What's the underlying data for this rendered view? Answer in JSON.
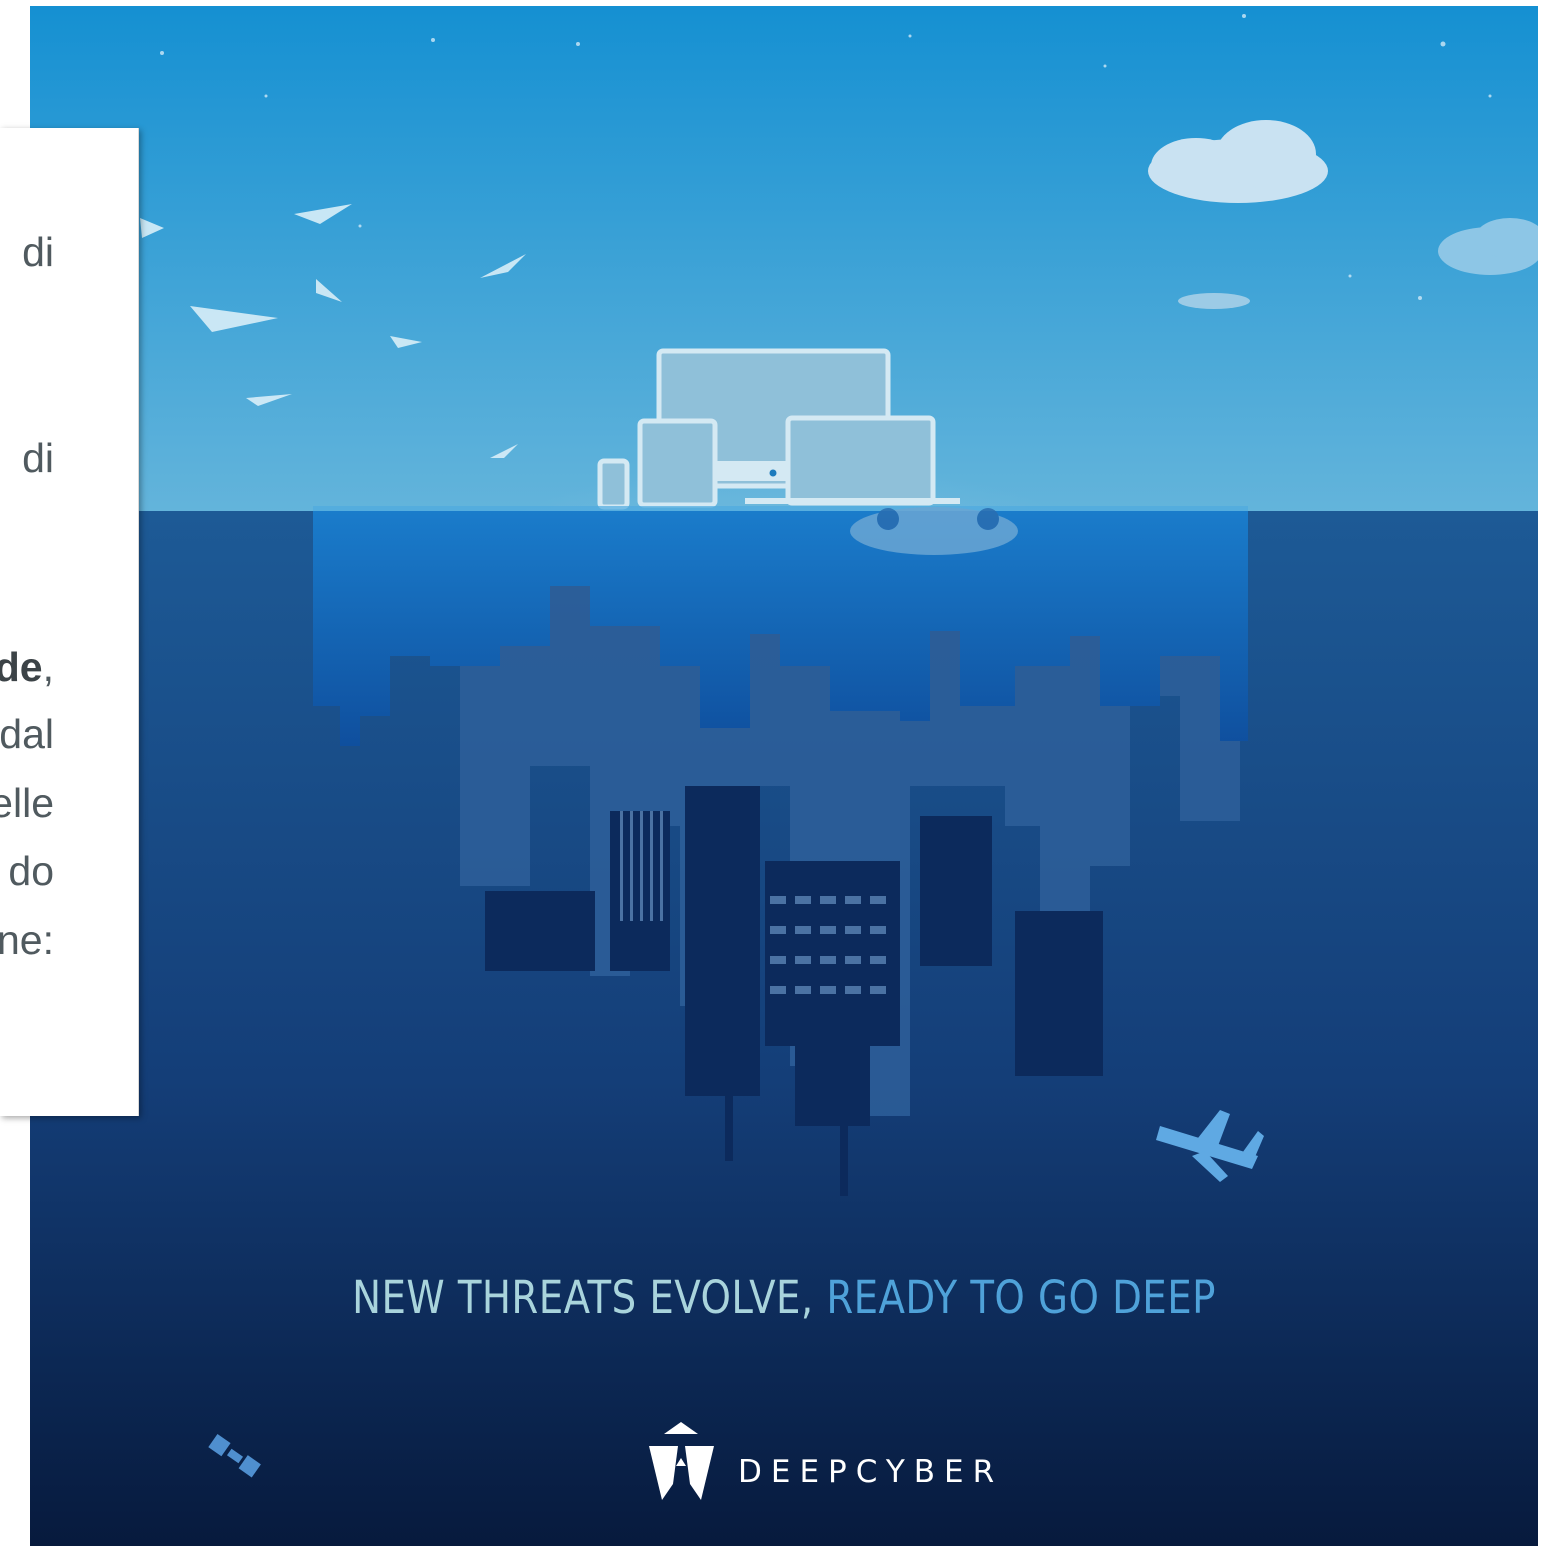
{
  "side_panel": {
    "fragments": [
      {
        "text": "di"
      },
      {
        "text": "di"
      },
      {
        "text": "de",
        "suffix": ","
      },
      {
        "text": "dal"
      },
      {
        "text": "elle"
      },
      {
        "text": "do"
      },
      {
        "text": "ne:"
      }
    ]
  },
  "poster": {
    "tagline_part1": "NEW THREATS EVOLVE, ",
    "tagline_part2": "READY TO GO DEEP",
    "brand_name": "DEEPCYBER"
  },
  "colors": {
    "sky_top": "#1590d2",
    "sky_bottom": "#63b4db",
    "water_top": "#1d5a96",
    "water_bottom": "#071a3d",
    "tagline_light": "#a9d4dc",
    "tagline_accent": "#4fa2d9"
  },
  "icons": [
    "cloud-icon",
    "bird-icon",
    "monitor-icon",
    "tablet-icon",
    "phone-icon",
    "laptop-icon",
    "airplane-icon",
    "satellite-icon",
    "deepcyber-logo-icon"
  ]
}
